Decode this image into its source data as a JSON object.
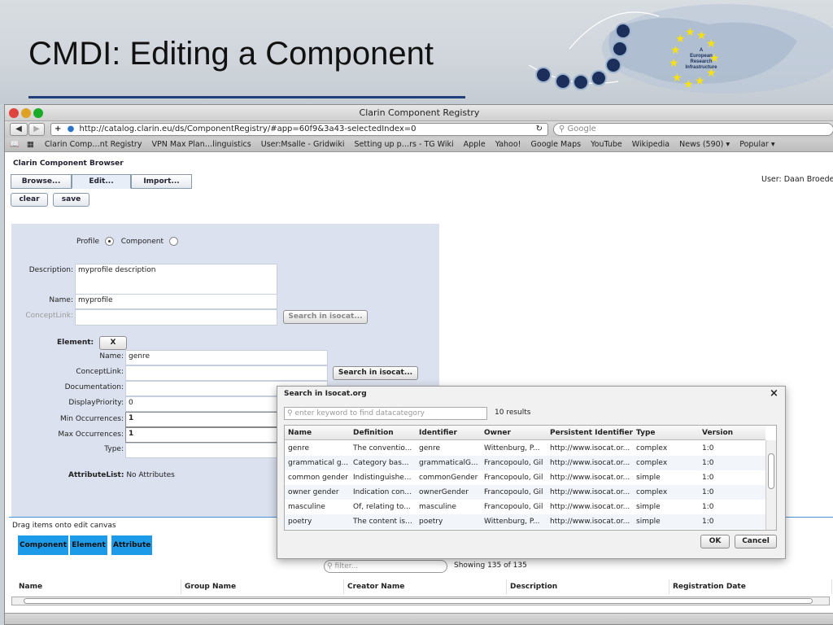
{
  "slide": {
    "title": "CMDI: Editing a Component"
  },
  "logo": {
    "line1": "A",
    "line2": "European",
    "line3": "Research",
    "line4": "Infrastructure"
  },
  "browser": {
    "window_title": "Clarin Component Registry",
    "url": "http://catalog.clarin.eu/ds/ComponentRegistry/#app=60f9&3a43-selectedIndex=0",
    "search_placeholder": "Google",
    "bookmarks": [
      "Clarin Comp…nt Registry",
      "VPN Max Plan…linguistics",
      "User:Msalle - Gridwiki",
      "Setting up p…rs - TG Wiki",
      "Apple",
      "Yahoo!",
      "Google Maps",
      "YouTube",
      "Wikipedia",
      "News (590) ▾",
      "Popular ▾"
    ]
  },
  "app": {
    "title": "Clarin Component Browser",
    "tabs": [
      "Browse...",
      "Edit...",
      "Import..."
    ],
    "user": "User: Daan Broeder",
    "clear": "clear",
    "save": "save"
  },
  "editor": {
    "profile_label": "Profile",
    "component_label": "Component",
    "description_label": "Description:",
    "description_value": "myprofile description",
    "name_label": "Name:",
    "name_value": "myprofile",
    "conceptlink_label": "ConceptLink:",
    "search_isocat": "Search in isocat...",
    "element_label": "Element:",
    "element_remove": "X",
    "el_name_label": "Name:",
    "el_name_value": "genre",
    "el_conceptlink_label": "ConceptLink:",
    "el_documentation_label": "Documentation:",
    "el_displaypriority_label": "DisplayPriority:",
    "el_displaypriority_value": "0",
    "el_min_label": "Min Occurrences:",
    "el_min_value": "1",
    "el_max_label": "Max Occurrences:",
    "el_max_value": "1",
    "el_type_label": "Type:",
    "attributelist_label": "AttributeList:",
    "attributelist_value": "No Attributes"
  },
  "palette": {
    "hint": "Drag items onto edit canvas",
    "items": [
      "Component",
      "Element",
      "Attribute"
    ]
  },
  "list": {
    "filter_placeholder": "filter...",
    "showing": "Showing 135 of 135",
    "columns": [
      "Name",
      "Group Name",
      "Creator Name",
      "Description",
      "Registration Date"
    ]
  },
  "dialog": {
    "title": "Search in Isocat.org",
    "search_placeholder": "enter keyword to find datacategory",
    "results": "10 results",
    "columns": [
      "Name",
      "Definition",
      "Identifier",
      "Owner",
      "Persistent Identifier",
      "Type",
      "Version"
    ],
    "rows": [
      [
        "genre",
        "The conventio...",
        "genre",
        "Wittenburg, P...",
        "http://www.isocat.or...",
        "complex",
        "1:0"
      ],
      [
        "grammatical g...",
        "Category bas...",
        "grammaticalG...",
        "Francopoulo, Gil",
        "http://www.isocat.or...",
        "complex",
        "1:0"
      ],
      [
        "common gender",
        "Indistinguishe...",
        "commonGender",
        "Francopoulo, Gil",
        "http://www.isocat.or...",
        "simple",
        "1:0"
      ],
      [
        "owner gender",
        "Indication con...",
        "ownerGender",
        "Francopoulo, Gil",
        "http://www.isocat.or...",
        "complex",
        "1:0"
      ],
      [
        "masculine",
        "Of, relating to...",
        "masculine",
        "Francopoulo, Gil",
        "http://www.isocat.or...",
        "simple",
        "1:0"
      ],
      [
        "poetry",
        "The content is...",
        "poetry",
        "Wittenburg, P...",
        "http://www.isocat.or...",
        "simple",
        "1:0"
      ]
    ],
    "ok": "OK",
    "cancel": "Cancel"
  }
}
